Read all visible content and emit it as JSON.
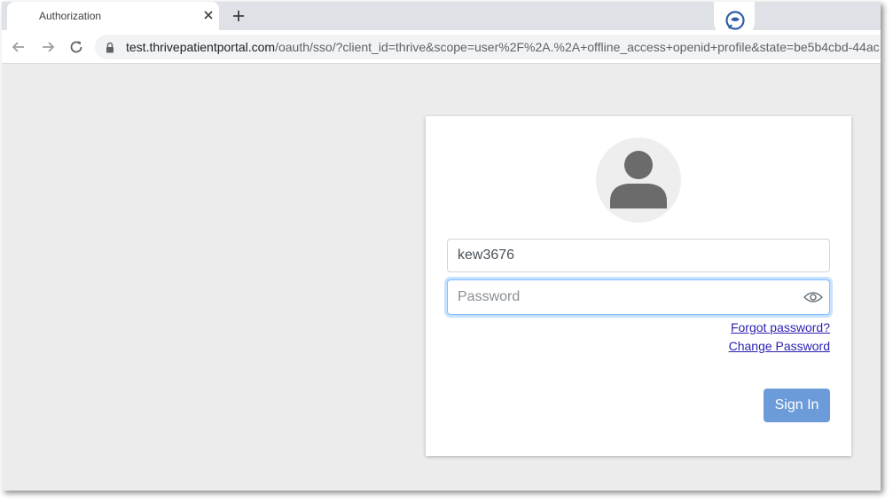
{
  "browser": {
    "tab": {
      "title": "Authorization"
    },
    "address_bar": {
      "url_host": "test.thrivepatientportal.com",
      "url_rest": "/oauth/sso/?client_id=thrive&scope=user%2F%2A.%2A+offline_access+openid+profile&state=be5b4cbd-44ac"
    }
  },
  "login": {
    "username_value": "kew3676",
    "password_placeholder": "Password",
    "forgot_password": "Forgot password?",
    "change_password": "Change Password",
    "sign_in": "Sign In"
  },
  "icons": {
    "back": "back-arrow-icon",
    "forward": "forward-arrow-icon",
    "reload": "reload-icon",
    "lock": "lock-icon",
    "close": "close-icon",
    "new_tab": "plus-icon",
    "extension": "chat-bubble-icon",
    "avatar": "user-avatar-icon",
    "show_password": "eye-icon"
  },
  "colors": {
    "sign_in_button": "#6b9bd8",
    "link": "#2a1fb0",
    "page_background": "#ececec",
    "focus_border": "#80bdff"
  }
}
